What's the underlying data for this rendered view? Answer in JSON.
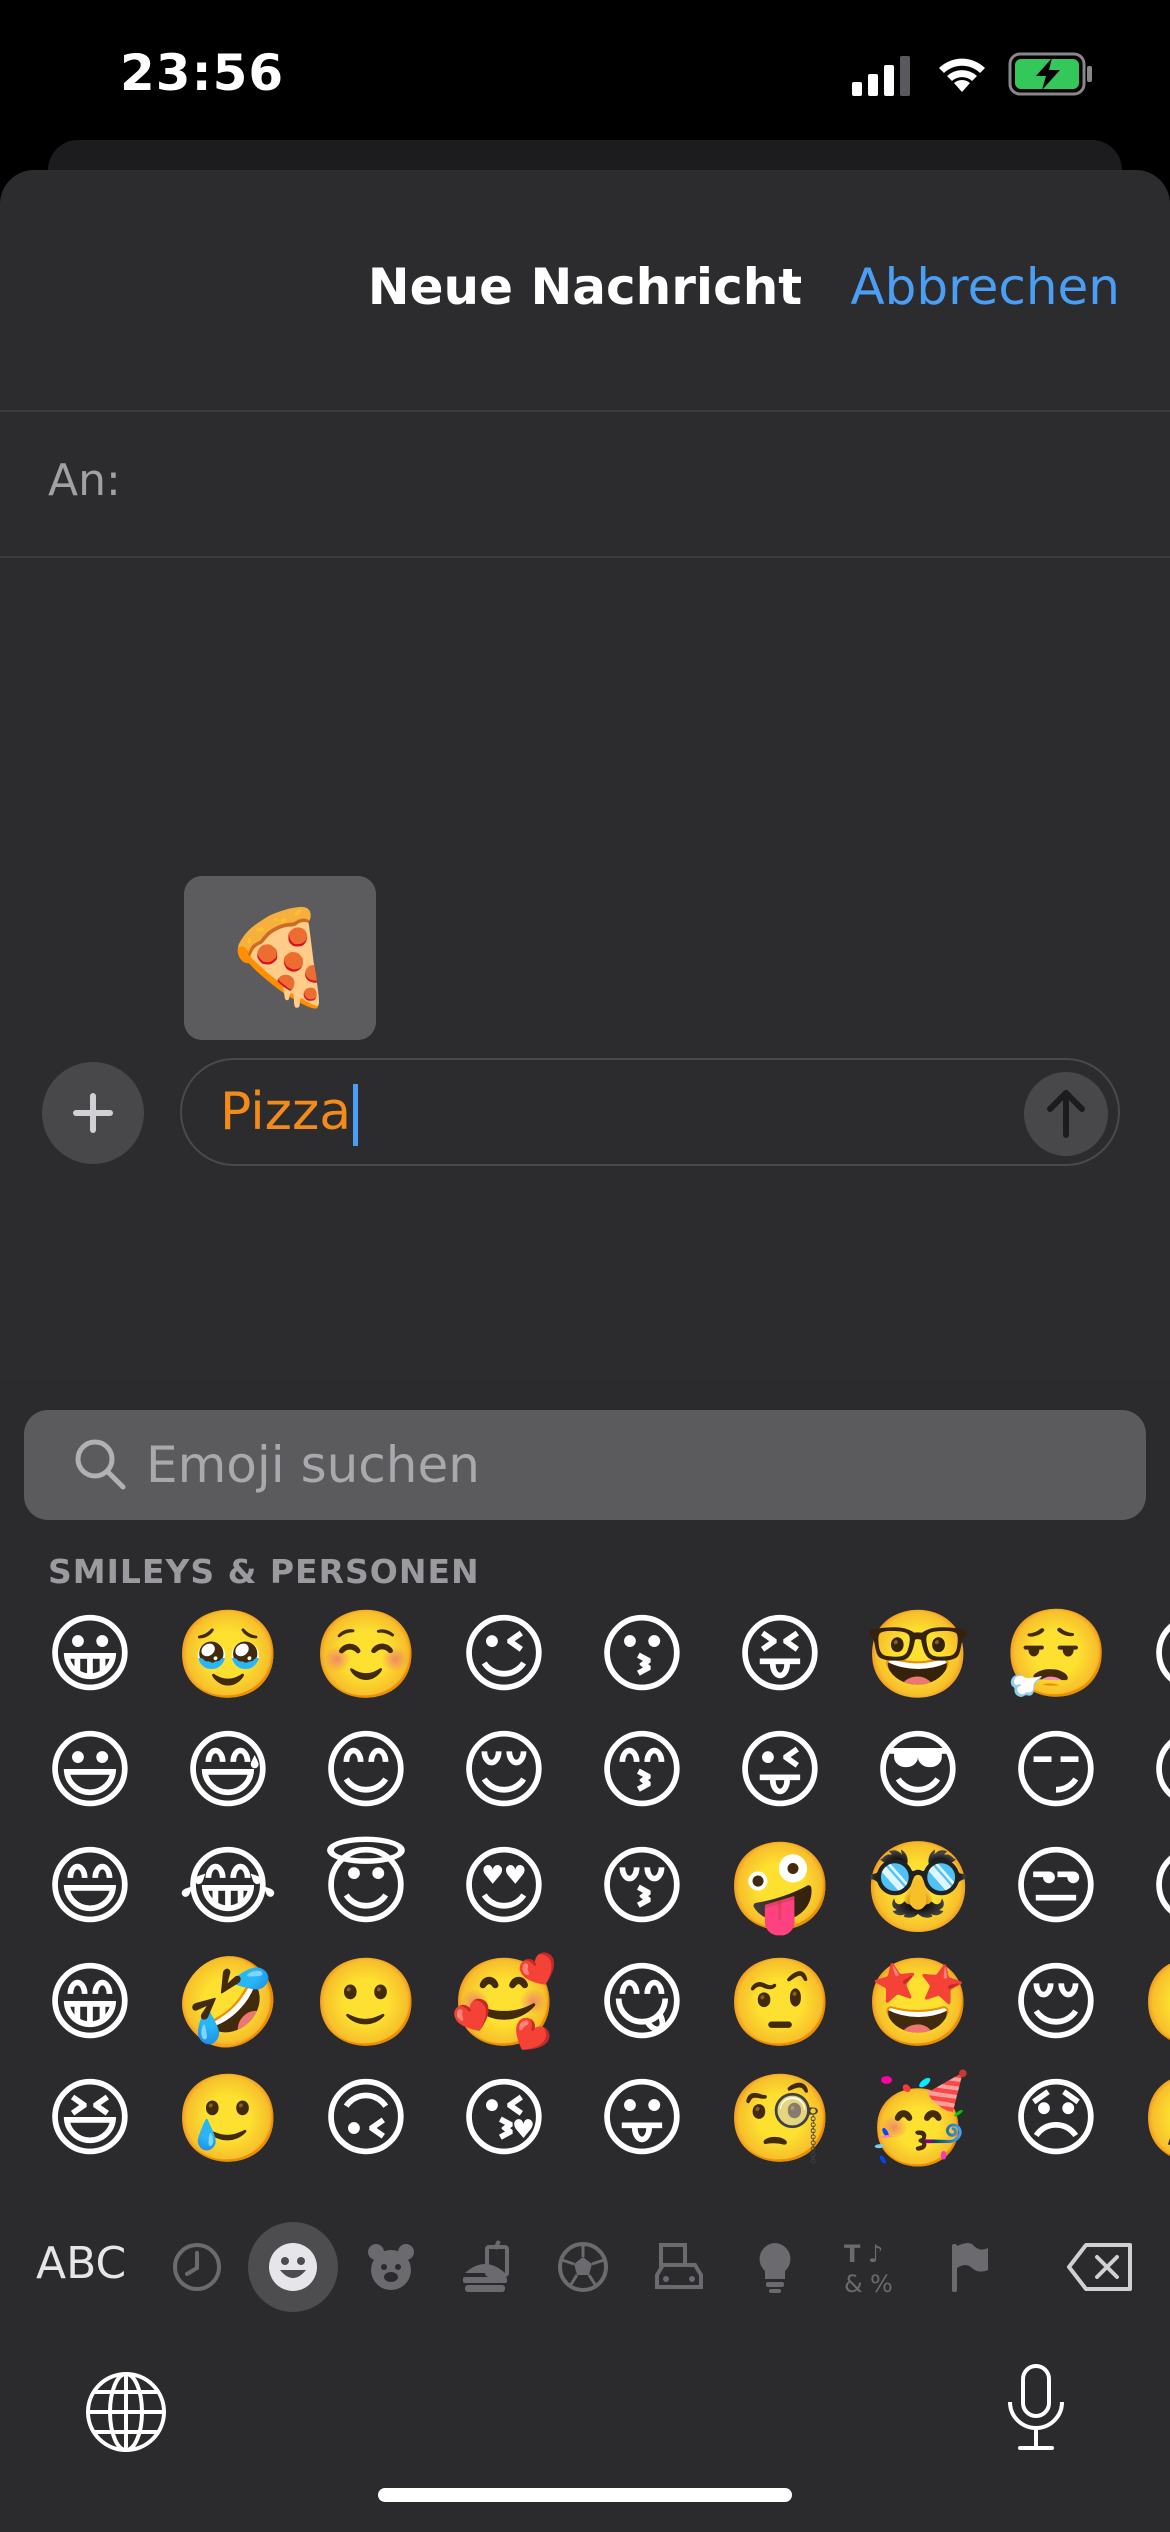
{
  "status": {
    "time": "23:56"
  },
  "header": {
    "title": "Neue Nachricht",
    "cancel_label": "Abbrechen"
  },
  "recipient": {
    "label": "An:"
  },
  "suggestion": {
    "emoji": "🍕"
  },
  "compose": {
    "text": "Pizza"
  },
  "keyboard": {
    "search_placeholder": "Emoji suchen",
    "category_title": "SMILEYS & PERSONEN",
    "abc_label": "ABC",
    "columns": [
      [
        "😀",
        "😃",
        "😄",
        "😁",
        "😆"
      ],
      [
        "🥹",
        "😅",
        "😂",
        "🤣",
        "🥲"
      ],
      [
        "☺️",
        "😊",
        "😇",
        "🙂",
        "🙃"
      ],
      [
        "😉",
        "😌",
        "😍",
        "🥰",
        "😘"
      ],
      [
        "😗",
        "😙",
        "😚",
        "😋",
        "😛"
      ],
      [
        "😝",
        "😜",
        "🤪",
        "🤨",
        "🧐"
      ],
      [
        "🤓",
        "😎",
        "🥸",
        "🤩",
        "🥳"
      ],
      [
        "😮‍💨",
        "😏",
        "😒",
        "😌",
        "😞"
      ],
      [
        "😔",
        "😟",
        "😕",
        "🙁",
        "☹️"
      ]
    ],
    "tabs": [
      "recent-icon",
      "smiley-icon",
      "animal-icon",
      "food-icon",
      "activity-icon",
      "travel-icon",
      "objects-icon",
      "symbols-icon",
      "flags-icon"
    ],
    "active_tab": "smiley-icon"
  },
  "colors": {
    "accent": "#4a9ff5",
    "input_text": "#f28b1c",
    "battery": "#34c759"
  }
}
